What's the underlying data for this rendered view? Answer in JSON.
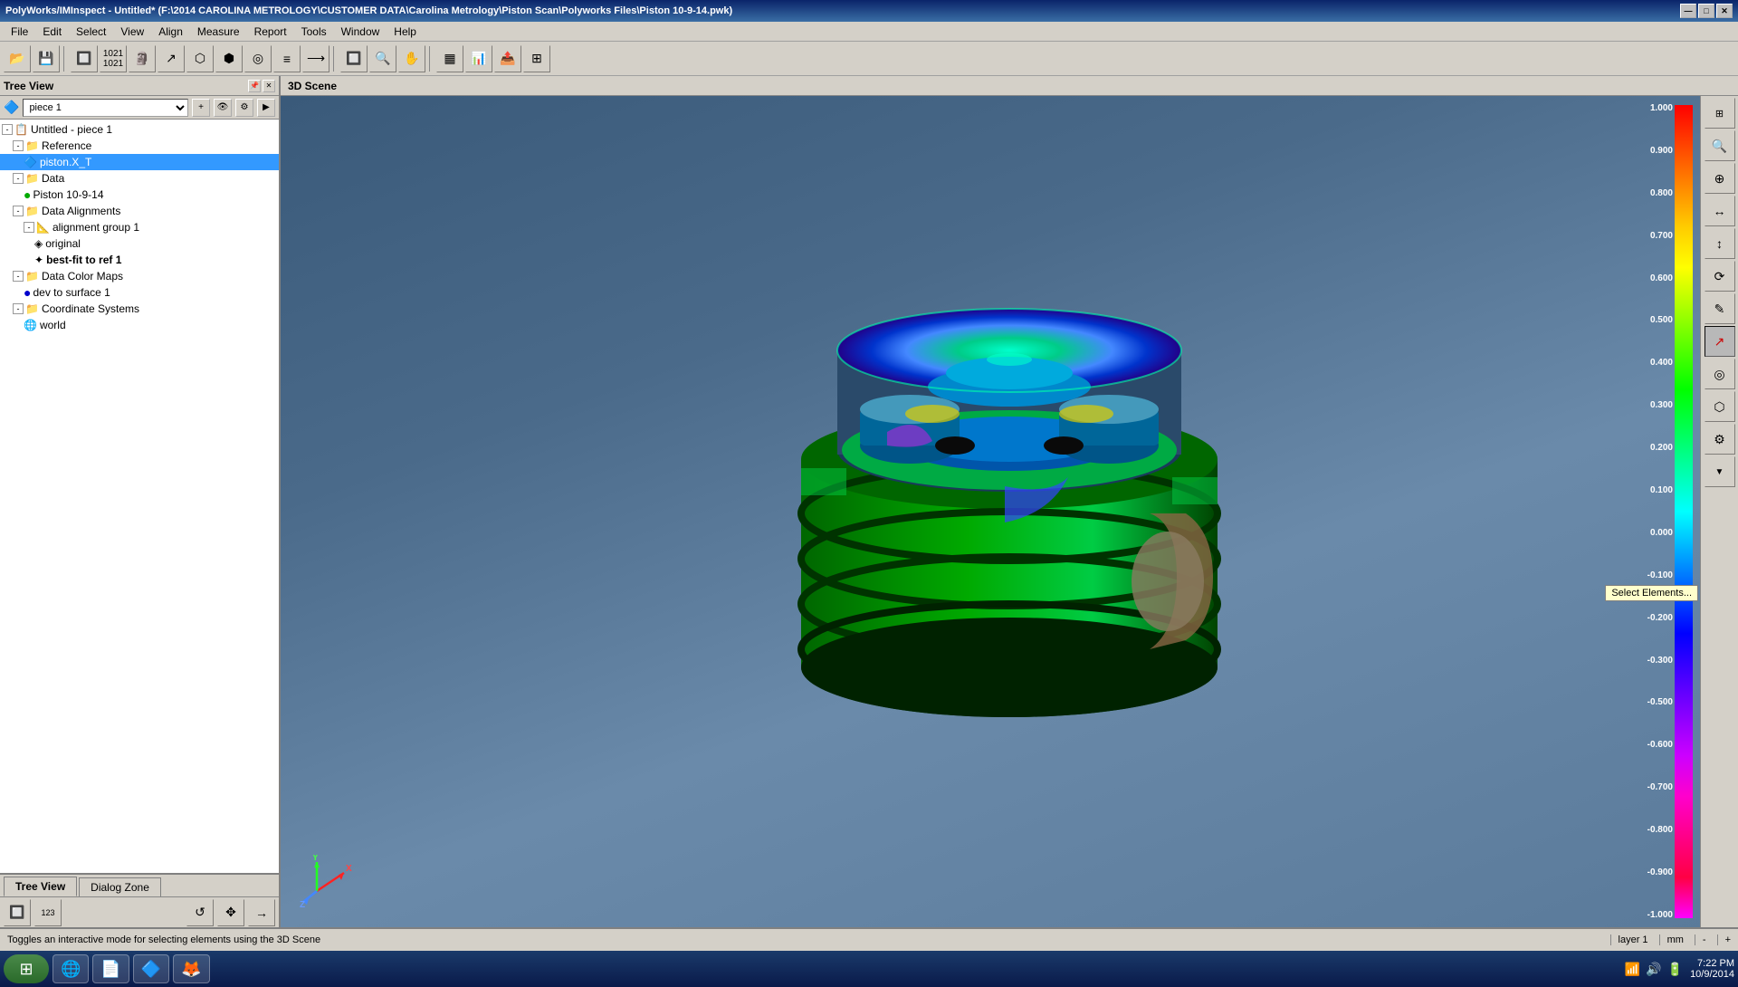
{
  "titlebar": {
    "text": "PolyWorks/IMInspect - Untitled* (F:\\2014 CAROLINA METROLOGY\\CUSTOMER DATA\\Carolina Metrology\\Piston Scan\\Polyworks Files\\Piston 10-9-14.pwk)",
    "minimize": "—",
    "maximize": "□",
    "close": "✕"
  },
  "menubar": {
    "items": [
      "File",
      "Edit",
      "Select",
      "View",
      "Align",
      "Measure",
      "Report",
      "Tools",
      "Window",
      "Help"
    ]
  },
  "treeview": {
    "title": "Tree View",
    "piece_label": "piece 1",
    "nodes": [
      {
        "id": "untitled",
        "label": "Untitled - piece 1",
        "indent": 0,
        "expand": "-",
        "icon": "📋"
      },
      {
        "id": "reference",
        "label": "Reference",
        "indent": 1,
        "expand": "-",
        "icon": "📁"
      },
      {
        "id": "pistonxt",
        "label": "piston.X_T",
        "indent": 2,
        "expand": null,
        "icon": "🔷",
        "selected": true
      },
      {
        "id": "data",
        "label": "Data",
        "indent": 1,
        "expand": "-",
        "icon": "📁"
      },
      {
        "id": "piston10-9-14",
        "label": "Piston 10-9-14",
        "indent": 2,
        "expand": null,
        "icon": "●",
        "dotcolor": "green"
      },
      {
        "id": "dataalignments",
        "label": "Data Alignments",
        "indent": 1,
        "expand": "-",
        "icon": "📁"
      },
      {
        "id": "aligngroup1",
        "label": "alignment group 1",
        "indent": 2,
        "expand": "-",
        "icon": "📐"
      },
      {
        "id": "original",
        "label": "original",
        "indent": 3,
        "expand": null,
        "icon": "◈"
      },
      {
        "id": "bestfit",
        "label": "best-fit to ref 1",
        "indent": 3,
        "expand": null,
        "icon": "✦"
      },
      {
        "id": "datacolormaps",
        "label": "Data Color Maps",
        "indent": 1,
        "expand": "-",
        "icon": "📁"
      },
      {
        "id": "devtosurface1",
        "label": "dev to surface 1",
        "indent": 2,
        "expand": null,
        "icon": "🎨",
        "dotcolor": "blue"
      },
      {
        "id": "coordsystems",
        "label": "Coordinate Systems",
        "indent": 1,
        "expand": "-",
        "icon": "📁"
      },
      {
        "id": "world",
        "label": "world",
        "indent": 2,
        "expand": null,
        "icon": "🌐"
      }
    ]
  },
  "tabs": {
    "items": [
      "Tree View",
      "Dialog Zone"
    ]
  },
  "scene": {
    "title": "3D Scene"
  },
  "scale": {
    "labels": [
      "1.000",
      "0.900",
      "0.800",
      "0.700",
      "0.600",
      "0.500",
      "0.400",
      "0.300",
      "0.200",
      "0.100",
      "0.000",
      "-0.100",
      "-0.200",
      "-0.300",
      "-0.500",
      "-0.600",
      "-0.700",
      "-0.800",
      "-0.900",
      "-1.000"
    ]
  },
  "tooltip": {
    "select_elements": "Select Elements..."
  },
  "statusbar": {
    "text": "Toggles an interactive mode for selecting elements using the 3D Scene",
    "layer": "layer 1",
    "unit": "mm",
    "zoom": ""
  },
  "taskbar": {
    "time": "7:22 PM",
    "date": "10/9/2014"
  }
}
